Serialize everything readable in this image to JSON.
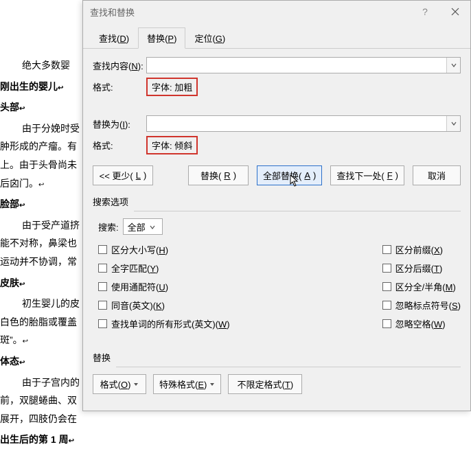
{
  "document": {
    "p1": "绝大多数婴",
    "h1": "刚出生的婴儿",
    "h2": "头部",
    "p2a": "由于分娩时受",
    "p2b": "肿形成的产瘤。有",
    "p2c": "上。由于头骨尚未",
    "p2d": "后囟门。",
    "h3": "脸部",
    "p3a": "由于受产道挤",
    "p3b": "能不对称，鼻梁也",
    "p3c": "运动并不协调，常",
    "h4": "皮肤",
    "p4a": "初生婴儿的皮",
    "p4b": "白色的胎脂或覆盖",
    "p4c": "斑”。",
    "h5": "体态",
    "p5a": "由于子宫内的",
    "p5b": "前，双腿蜷曲、双",
    "p5c": "展开，四肢仍会在",
    "h6": "出生后的第 1 周"
  },
  "dialog": {
    "title": "查找和替换",
    "help": "?",
    "tabs": {
      "find": "查找(",
      "find_u": "D",
      "find_end": ")",
      "replace": "替换(",
      "replace_u": "P",
      "replace_end": ")",
      "goto": "定位(",
      "goto_u": "G",
      "goto_end": ")"
    },
    "find_label": "查找内容(",
    "find_u": "N",
    "find_end": "):",
    "format_label": "格式:",
    "find_format_value": "字体: 加粗",
    "replace_label": "替换为(",
    "replace_u": "I",
    "replace_end": "):",
    "replace_format_value": "字体: 倾斜",
    "less_btn": "<< 更少(",
    "less_u": "L",
    "less_end": ")",
    "replace_btn": "替换(",
    "replace_btn_u": "R",
    "replace_btn_end": ")",
    "replace_all_btn": "全部替换(",
    "replace_all_u": "A",
    "replace_all_end": ")",
    "find_next_btn": "查找下一处(",
    "find_next_u": "F",
    "find_next_end": ")",
    "cancel_btn": "取消",
    "search_options": "搜索选项",
    "search_label": "搜索:",
    "search_value": "全部",
    "chk_case": "区分大小写(",
    "chk_case_u": "H",
    "chk_case_end": ")",
    "chk_whole": "全字匹配(",
    "chk_whole_u": "Y",
    "chk_whole_end": ")",
    "chk_wildcard": "使用通配符(",
    "chk_wildcard_u": "U",
    "chk_wildcard_end": ")",
    "chk_sounds": "同音(英文)(",
    "chk_sounds_u": "K",
    "chk_sounds_end": ")",
    "chk_forms": "查找单词的所有形式(英文)(",
    "chk_forms_u": "W",
    "chk_forms_end": ")",
    "chk_prefix": "区分前缀(",
    "chk_prefix_u": "X",
    "chk_prefix_end": ")",
    "chk_suffix": "区分后缀(",
    "chk_suffix_u": "T",
    "chk_suffix_end": ")",
    "chk_width": "区分全/半角(",
    "chk_width_u": "M",
    "chk_width_end": ")",
    "chk_punct": "忽略标点符号(",
    "chk_punct_u": "S",
    "chk_punct_end": ")",
    "chk_space": "忽略空格(",
    "chk_space_u": "W",
    "chk_space_end": ")",
    "replace_section": "替换",
    "format_btn": "格式(",
    "format_btn_u": "O",
    "format_btn_end": ")",
    "special_btn": "特殊格式(",
    "special_btn_u": "E",
    "special_btn_end": ")",
    "noformat_btn": "不限定格式(",
    "noformat_btn_u": "T",
    "noformat_btn_end": ")"
  }
}
